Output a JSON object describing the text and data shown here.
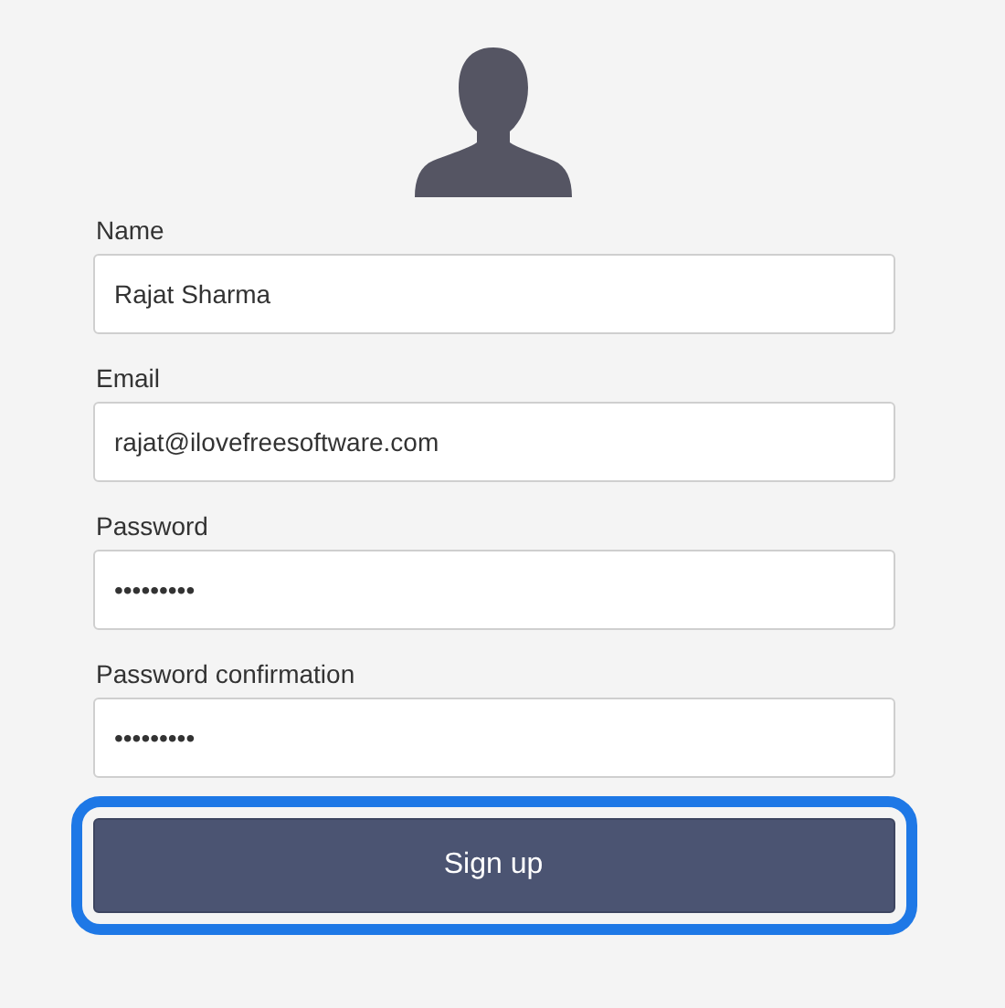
{
  "fields": [
    {
      "label": "Name",
      "value": "Rajat Sharma"
    },
    {
      "label": "Email",
      "value": "rajat@ilovefreesoftware.com"
    },
    {
      "label": "Password",
      "value": "•••••••••"
    },
    {
      "label": "Password confirmation",
      "value": "•••••••••"
    }
  ],
  "button": {
    "label": "Sign up",
    "focused": true
  }
}
